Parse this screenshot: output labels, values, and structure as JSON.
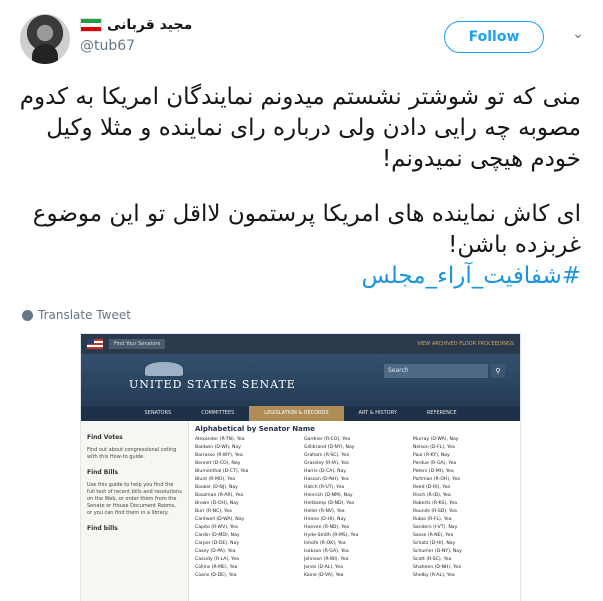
{
  "tweet": {
    "display_name": "مجید قربانی",
    "handle": "@tub67",
    "follow_label": "Follow",
    "paragraph1": [
      "منی که تو شوشتر نشستم میدونم نمایندگان امریکا به کدوم",
      "مصوبه چه رایی دادن ولی درباره رای نماینده و مثلا وکیل",
      "خودم هیچی نمیدونم!"
    ],
    "paragraph2": [
      "ای کاش نماینده های امریکا پرستمون لااقل تو این موضوع",
      "غربزده باشن!"
    ],
    "hashtag": "#شفافیت_آراء_مجلس",
    "translate_label": "Translate Tweet",
    "flag_colors": [
      "#239f40",
      "#ffffff",
      "#da0000"
    ]
  },
  "screenshot": {
    "find_senators": "Find Your Senators",
    "archive_link": "VIEW ARCHIVED FLOOR PROCEEDINGS",
    "logo": "UNITED STATES SENATE",
    "search_placeholder": "Search",
    "nav": [
      "SENATORS",
      "COMMITTEES",
      "LEGISLATION & RECORDS",
      "ART & HISTORY",
      "REFERENCE"
    ],
    "sidebar": [
      {
        "title": "Find Votes",
        "text": "Find out about congressional voting with this How-to guide."
      },
      {
        "title": "Find Bills",
        "text": "Use this guide to help you find the full text of recent bills and resolutions on the Web, or order them from the Senate or House Document Rooms, or you can find them in a library."
      },
      {
        "title": "Find bills",
        "text": ""
      }
    ],
    "list_title": "Alphabetical by Senator Name",
    "col1": [
      "Alexander (R-TN), Yea",
      "Baldwin (D-WI), Nay",
      "Barrasso (R-WY), Yea",
      "Bennet (D-CO), Nay",
      "Blumenthal (D-CT), Yea",
      "Blunt (R-MO), Yea",
      "Booker (D-NJ), Nay",
      "Boozman (R-AR), Yea",
      "Brown (D-OH), Nay",
      "Burr (R-NC), Yea",
      "Cantwell (D-WA), Nay",
      "Capito (R-WV), Yea",
      "Cardin (D-MD), Nay",
      "Carper (D-DE), Nay",
      "Casey (D-PA), Yea",
      "Cassidy (R-LA), Yea",
      "Collins (R-ME), Yea",
      "Coons (D-DE), Yea"
    ],
    "col2": [
      "Gardner (R-CO), Yea",
      "Gillibrand (D-NY), Nay",
      "Graham (R-SC), Yea",
      "Grassley (R-IA), Yea",
      "Harris (D-CA), Nay",
      "Hassan (D-NH), Yea",
      "Hatch (R-UT), Yea",
      "Heinrich (D-NM), Nay",
      "Heitkamp (D-ND), Yea",
      "Heller (R-NV), Yea",
      "Hirono (D-HI), Nay",
      "Hoeven (R-ND), Yea",
      "Hyde-Smith (R-MS), Yea",
      "Inhofe (R-OK), Yea",
      "Isakson (R-GA), Yea",
      "Johnson (R-WI), Yea",
      "Jones (D-AL), Yea",
      "Kaine (D-VA), Yea"
    ],
    "col3": [
      "Murray (D-WA), Nay",
      "Nelson (D-FL), Yea",
      "Paul (R-KY), Nay",
      "Perdue (R-GA), Yea",
      "Peters (D-MI), Yea",
      "Portman (R-OH), Yea",
      "Reed (D-RI), Yea",
      "Risch (R-ID), Yea",
      "Roberts (R-KS), Yea",
      "Rounds (R-SD), Yea",
      "Rubio (R-FL), Yea",
      "Sanders (I-VT), Nay",
      "Sasse (R-NE), Yea",
      "Schatz (D-HI), Nay",
      "Schumer (D-NY), Nay",
      "Scott (R-SC), Yea",
      "Shaheen (D-NH), Yea",
      "Shelby (R-AL), Yea"
    ]
  }
}
